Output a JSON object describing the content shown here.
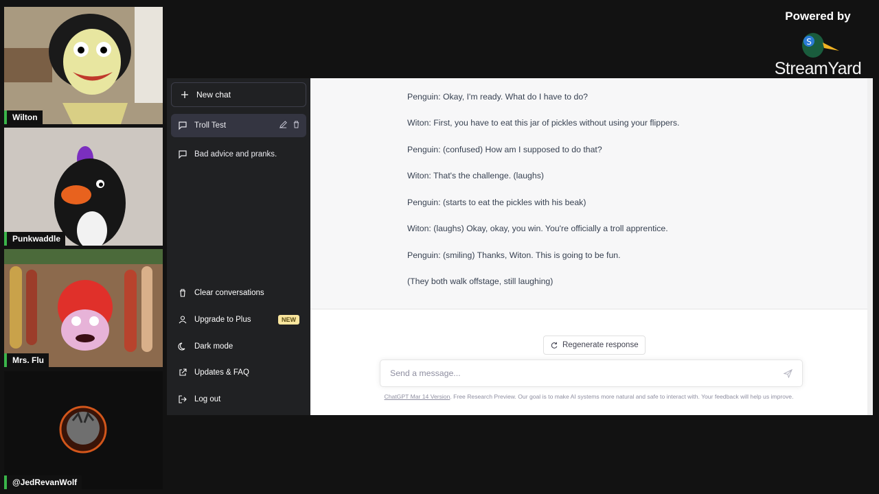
{
  "participants": [
    {
      "name": "Wilton"
    },
    {
      "name": "Punkwaddle"
    },
    {
      "name": "Mrs. Flu"
    },
    {
      "name": "@JedRevanWolf"
    }
  ],
  "branding": {
    "powered_by": "Powered by",
    "product": "StreamYard"
  },
  "sidebar": {
    "new_chat": "New chat",
    "conversations": [
      {
        "label": "Troll Test",
        "active": true
      },
      {
        "label": "Bad advice and pranks.",
        "active": false
      }
    ],
    "bottom": {
      "clear": "Clear conversations",
      "upgrade": "Upgrade to Plus",
      "upgrade_badge": "NEW",
      "dark_mode": "Dark mode",
      "updates": "Updates & FAQ",
      "logout": "Log out"
    }
  },
  "chat": {
    "lines": [
      "Penguin: Okay, I'm ready. What do I have to do?",
      "Witon: First, you have to eat this jar of pickles without using your flippers.",
      "Penguin: (confused) How am I supposed to do that?",
      "Witon: That's the challenge. (laughs)",
      "Penguin: (starts to eat the pickles with his beak)",
      "Witon: (laughs) Okay, okay, you win. You're officially a troll apprentice.",
      "Penguin: (smiling) Thanks, Witon. This is going to be fun.",
      "(They both walk offstage, still laughing)"
    ],
    "regenerate": "Regenerate response",
    "input_placeholder": "Send a message...",
    "footer_version": "ChatGPT Mar 14 Version",
    "footer_text": ". Free Research Preview. Our goal is to make AI systems more natural and safe to interact with. Your feedback will help us improve."
  },
  "colors": {
    "sidebar_bg": "#202123",
    "active_conv": "#343541",
    "badge_bg": "#fae69e",
    "speaker_indicator": "#3ab54a"
  }
}
